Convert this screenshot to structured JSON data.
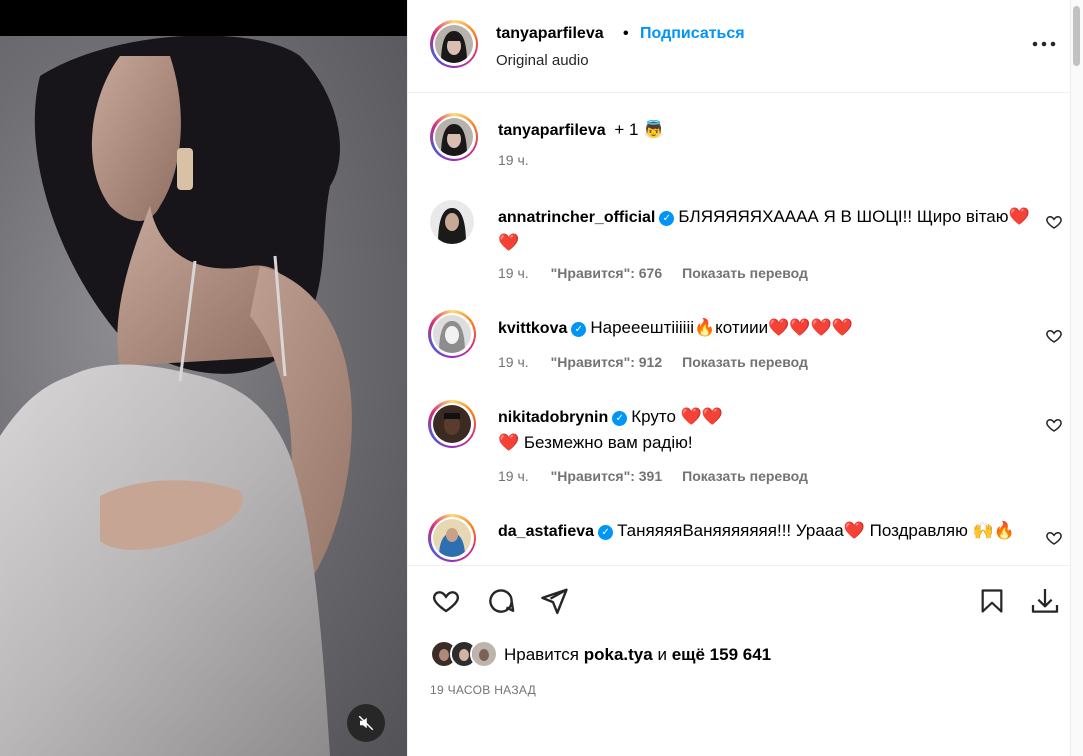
{
  "post": {
    "author": "tanyaparfileva",
    "dot": "•",
    "follow_label": "Подписаться",
    "audio": "Original audio"
  },
  "caption": {
    "author": "tanyaparfileva",
    "suffix": "+ 1",
    "emoji": "👼",
    "time": "19 ч."
  },
  "comments": [
    {
      "user": "annatrincher_official",
      "verified": true,
      "text": "БЛЯЯЯЯЯХАААА Я В ШОЦІ!! Щиро вітаю❤️❤️",
      "time": "19 ч.",
      "likes": "\"Нравится\": 676",
      "translate": "Показать перевод"
    },
    {
      "user": "kvittkova",
      "verified": true,
      "text": "Нарееештіііііі🔥котиии❤️❤️❤️❤️",
      "time": "19 ч.",
      "likes": "\"Нравится\": 912",
      "translate": "Показать перевод"
    },
    {
      "user": "nikitadobrynin",
      "verified": true,
      "text": "Круто ❤️❤️❤️ Безмежно вам радію!",
      "time": "19 ч.",
      "likes": "\"Нравится\": 391",
      "translate": "Показать перевод"
    },
    {
      "user": "da_astafieva",
      "verified": true,
      "text": "ТаняяяяВаняяяяяяя!!! Урааа❤️ Поздравляю 🙌🔥",
      "time": "",
      "likes": "",
      "translate": ""
    }
  ],
  "likes": {
    "prefix": "Нравится",
    "user": "poka.tya",
    "mid": "и",
    "rest": "ещё 159 641"
  },
  "time_ago": "19 ЧАСОВ НАЗАД",
  "colors": {
    "accent": "#0095f6",
    "heart": "#e0112b",
    "meta": "#737373"
  },
  "icons": [
    "like-icon",
    "comment-icon",
    "share-icon",
    "save-icon",
    "download-icon",
    "more-icon",
    "mute-icon",
    "verified-badge-icon"
  ]
}
